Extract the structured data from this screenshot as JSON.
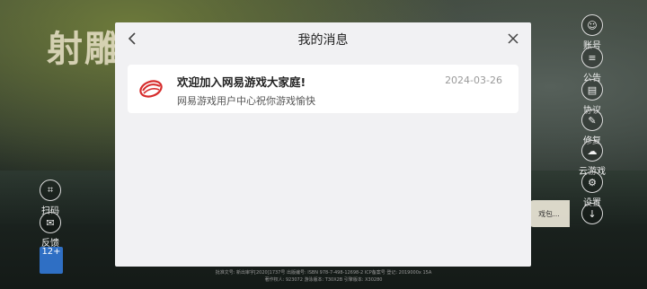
{
  "background": {
    "game_logo_text": "射雕",
    "side_buttons": [
      {
        "label": "账号",
        "icon": "account-icon"
      },
      {
        "label": "公告",
        "icon": "notice-icon"
      },
      {
        "label": "协议",
        "icon": "agreement-icon"
      },
      {
        "label": "修复",
        "icon": "repair-icon"
      },
      {
        "label": "云游戏",
        "icon": "cloud-game-icon"
      },
      {
        "label": "设置",
        "icon": "settings-icon"
      }
    ],
    "left_buttons": [
      {
        "label": "扫码",
        "icon": "scan-icon"
      },
      {
        "label": "反馈",
        "icon": "feedback-icon"
      }
    ],
    "age_badge": "12+",
    "download_pill": "戏包...",
    "footer_lines": [
      "批准文号: 新出审字[2020]1737号  出版编号: ISBN 978-7-498-12698-2  ICP备案号  登记: 2019000x  15A",
      "著作权人: 923072  游泳版本: T30X2B  引擎版本: X30280"
    ]
  },
  "modal": {
    "title": "我的消息",
    "back_icon": "chevron-left-icon",
    "close_icon": "close-icon",
    "messages": [
      {
        "logo": "netease-logo-icon",
        "title": "欢迎加入网易游戏大家庭!",
        "date": "2024-03-26",
        "body": "网易游戏用户中心祝你游戏愉快"
      }
    ]
  },
  "colors": {
    "modal_bg": "#f1f1f3",
    "card_bg": "#ffffff",
    "brand_red": "#d62c2c"
  }
}
